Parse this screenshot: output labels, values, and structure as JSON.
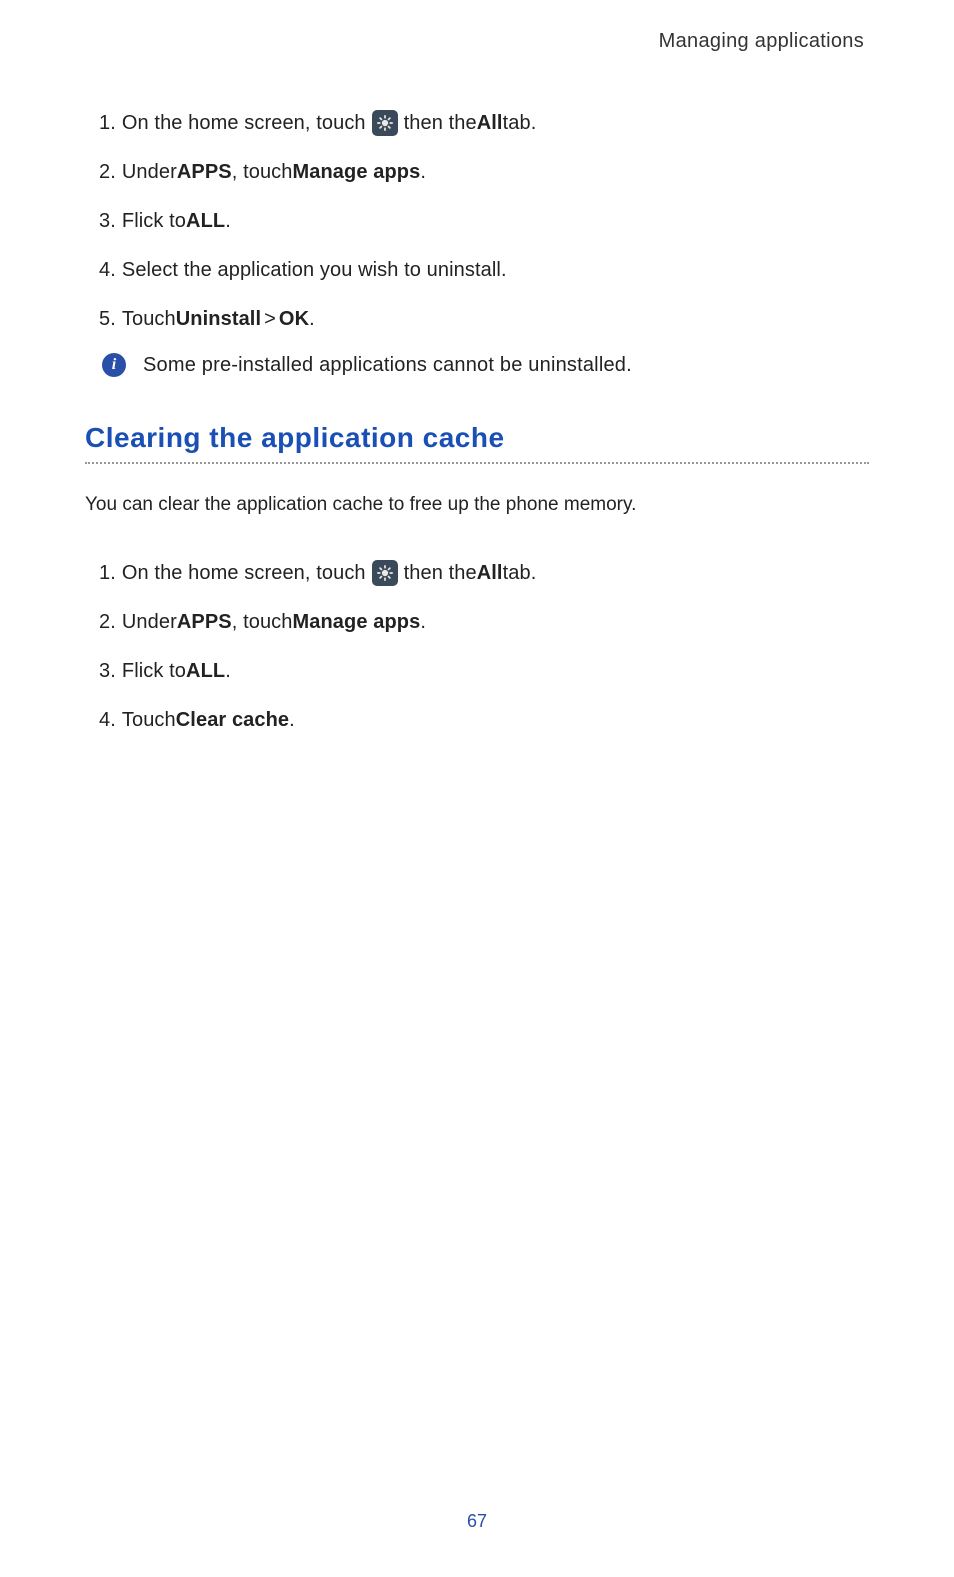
{
  "header": {
    "title": "Managing applications"
  },
  "uninstall_steps": {
    "step1": {
      "num": "1. ",
      "pre": "On the home screen, touch ",
      "post_pre": " then the ",
      "bold": "All",
      "post": " tab."
    },
    "step2": {
      "num": "2. ",
      "pre": "Under ",
      "bold1": "APPS",
      "mid": ", touch ",
      "bold2": "Manage apps",
      "post": "."
    },
    "step3": {
      "num": "3. ",
      "pre": "Flick to ",
      "bold": "ALL",
      "post": "."
    },
    "step4": {
      "num": "4. ",
      "text": "Select the application you wish to uninstall."
    },
    "step5": {
      "num": "5. ",
      "pre": "Touch ",
      "bold1": "Uninstall",
      "gt": " > ",
      "bold2": "OK",
      "post": "."
    }
  },
  "note": {
    "icon_label": "i",
    "text": "Some pre-installed applications cannot be uninstalled."
  },
  "section2": {
    "heading": "Clearing the application cache",
    "intro": "You can clear the application cache to free up the phone memory."
  },
  "cache_steps": {
    "step1": {
      "num": "1. ",
      "pre": "On the home screen, touch ",
      "post_pre": " then the ",
      "bold": "All",
      "post": " tab."
    },
    "step2": {
      "num": "2. ",
      "pre": "Under ",
      "bold1": "APPS",
      "mid": ", touch ",
      "bold2": "Manage apps",
      "post": "."
    },
    "step3": {
      "num": "3. ",
      "pre": "Flick to ",
      "bold": "ALL",
      "post": "."
    },
    "step4": {
      "num": "4. ",
      "pre": "Touch ",
      "bold": "Clear cache",
      "post": "."
    }
  },
  "page_number": "67"
}
